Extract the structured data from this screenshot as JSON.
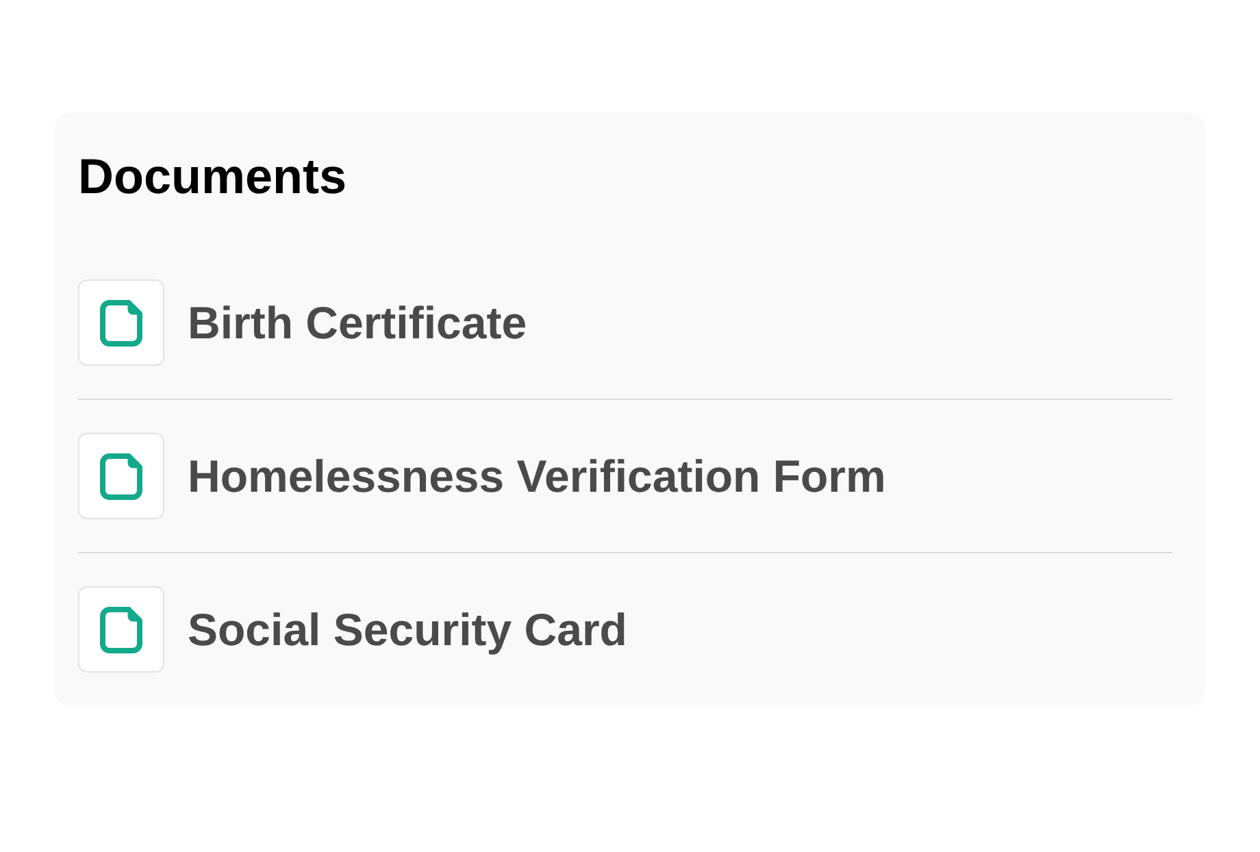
{
  "card": {
    "title": "Documents",
    "documents": [
      {
        "name": "Birth Certificate"
      },
      {
        "name": "Homelessness Verification Form"
      },
      {
        "name": "Social Security Card"
      }
    ]
  }
}
